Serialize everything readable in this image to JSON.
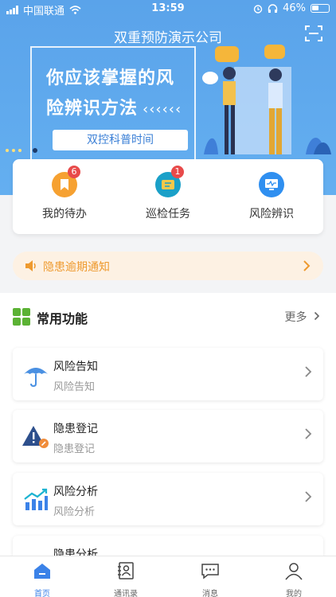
{
  "status_bar": {
    "carrier": "中国联通",
    "time": "13:59",
    "battery": "46%"
  },
  "header": {
    "title": "双重预防演示公司"
  },
  "banner": {
    "line1": "你应该掌握的风",
    "line2": "险辨识方法",
    "chevrons": "‹‹‹‹‹‹",
    "pill": "双控科普时间"
  },
  "quick_actions": [
    {
      "label": "我的待办",
      "badge": "6",
      "icon": "bookmark-icon",
      "color": "#f6a131"
    },
    {
      "label": "巡检任务",
      "badge": "1",
      "icon": "inspection-icon",
      "color": "#1aa0c8"
    },
    {
      "label": "风险辨识",
      "badge": "",
      "icon": "monitor-icon",
      "color": "#2f8ff0"
    }
  ],
  "notice": {
    "text": "隐患逾期通知"
  },
  "section": {
    "title": "常用功能",
    "more": "更多"
  },
  "functions": [
    {
      "title": "风险告知",
      "subtitle": "风险告知",
      "icon": "umbrella-icon"
    },
    {
      "title": "隐患登记",
      "subtitle": "隐患登记",
      "icon": "warning-icon"
    },
    {
      "title": "风险分析",
      "subtitle": "风险分析",
      "icon": "chart-icon"
    },
    {
      "title": "隐患分析",
      "subtitle": "",
      "icon": "analysis-icon"
    }
  ],
  "tabs": [
    {
      "label": "首页",
      "icon": "home-icon",
      "active": true
    },
    {
      "label": "通讯录",
      "icon": "contacts-icon",
      "active": false
    },
    {
      "label": "消息",
      "icon": "message-icon",
      "active": false
    },
    {
      "label": "我的",
      "icon": "profile-icon",
      "active": false
    }
  ],
  "colors": {
    "accent": "#3b82e8",
    "banner": "#5aa3ea",
    "warning": "#ee9a2f",
    "badge": "#e84a4a"
  }
}
